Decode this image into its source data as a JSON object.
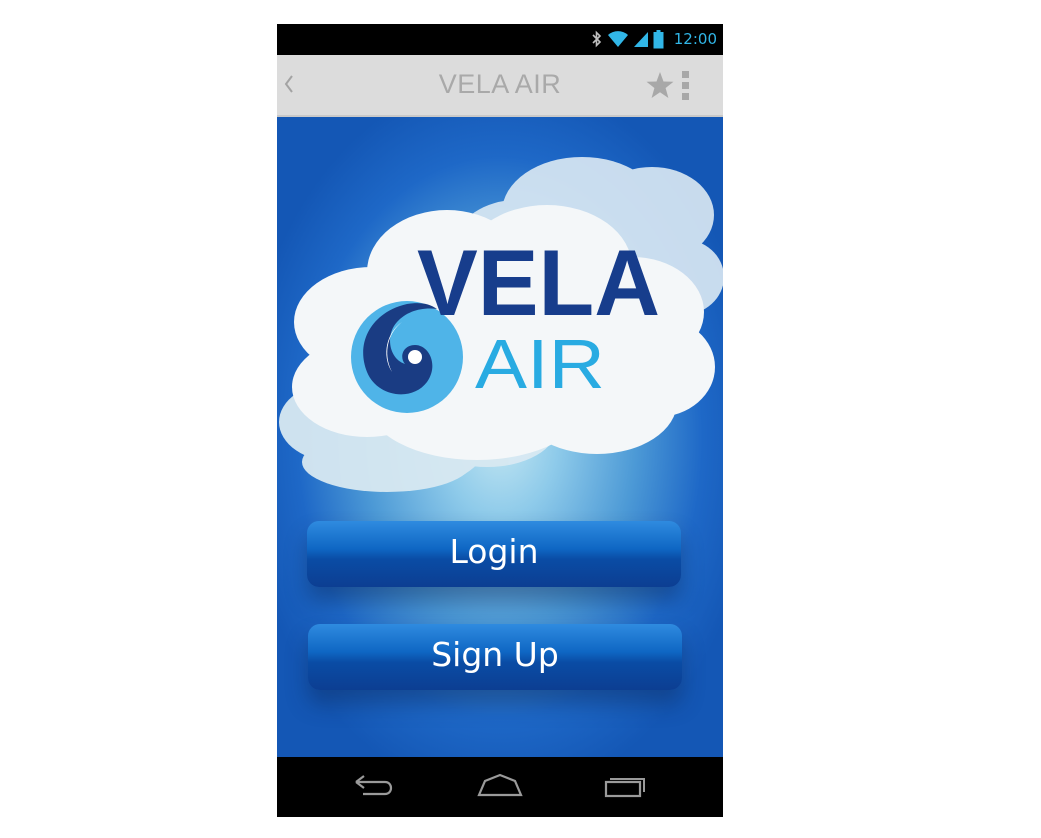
{
  "status_bar": {
    "time": "12:00",
    "icons": [
      "bluetooth-icon",
      "wifi-icon",
      "signal-icon",
      "battery-icon"
    ],
    "accent_color": "#31b6e7"
  },
  "action_bar": {
    "title": "VELA AIR",
    "icons": [
      "back-icon",
      "star-icon",
      "overflow-menu-icon"
    ]
  },
  "logo": {
    "line1": "VELA",
    "line2": "AIR",
    "colors": {
      "dark": "#173d8c",
      "light": "#29abe2"
    }
  },
  "buttons": {
    "login": "Login",
    "signup": "Sign Up"
  },
  "nav_bar": {
    "icons": [
      "nav-back-icon",
      "nav-home-icon",
      "nav-recents-icon"
    ]
  }
}
